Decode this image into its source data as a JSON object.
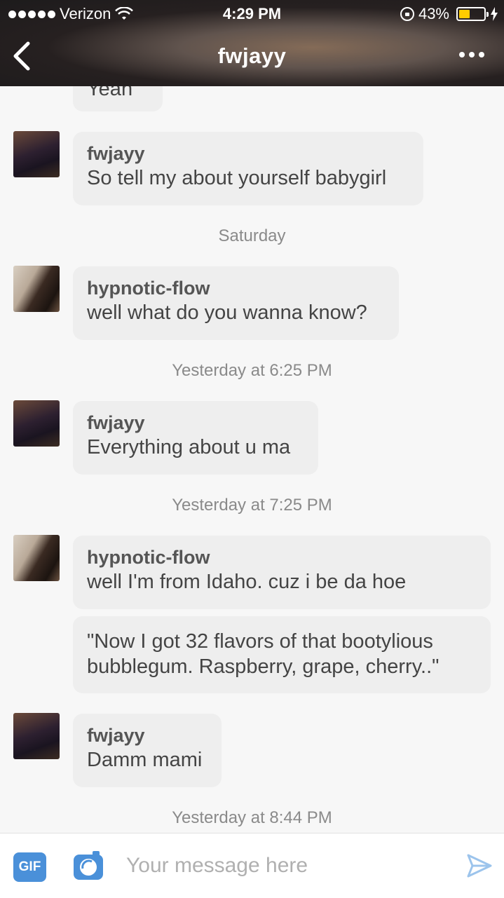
{
  "status_bar": {
    "carrier": "Verizon",
    "time": "4:29 PM",
    "battery_percent": "43%",
    "battery_level": 0.43
  },
  "nav": {
    "title": "fwjayy"
  },
  "messages": {
    "m0": {
      "text": "Yeah"
    },
    "m1": {
      "sender": "fwjayy",
      "text": "So tell my about yourself babygirl"
    },
    "t1": "Saturday",
    "m2": {
      "sender": "hypnotic-flow",
      "text": "well what do you wanna know?"
    },
    "t2": "Yesterday at 6:25 PM",
    "m3": {
      "sender": "fwjayy",
      "text": "Everything about u ma"
    },
    "t3": "Yesterday at 7:25 PM",
    "m4": {
      "sender": "hypnotic-flow",
      "text": "well I'm from Idaho. cuz i be da hoe"
    },
    "m5": {
      "text": "\"Now I got 32 flavors of that bootylious bubblegum. Raspberry, grape, cherry..\""
    },
    "m6": {
      "sender": "fwjayy",
      "text": "Damm mami"
    },
    "t4": "Yesterday at 8:44 PM"
  },
  "composer": {
    "gif_label": "GIF",
    "placeholder": "Your message here"
  },
  "colors": {
    "accent": "#4a90d9",
    "bubble": "#eeeeee",
    "battery": "#ffcc00"
  }
}
